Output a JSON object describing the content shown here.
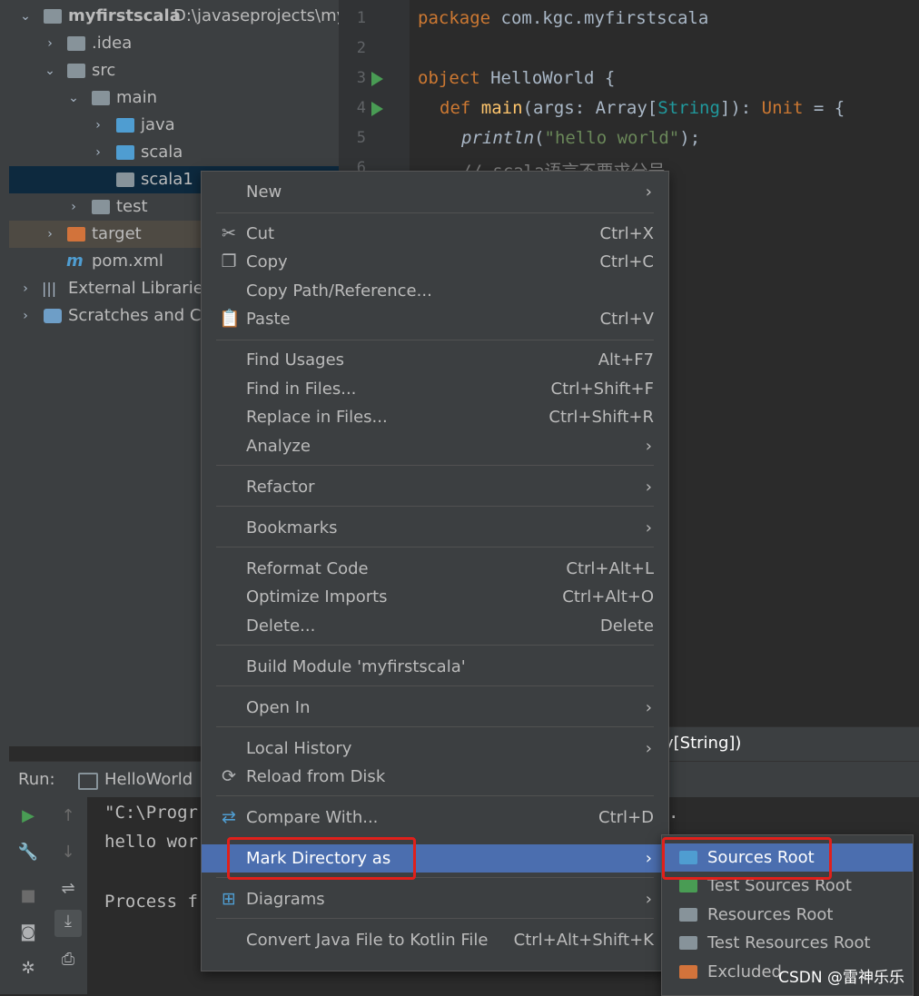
{
  "project_tree": {
    "root": {
      "name": "myfirstscala",
      "path": "D:\\javaseprojects\\my"
    },
    "items": [
      {
        "label": ".idea"
      },
      {
        "label": "src"
      },
      {
        "label": "main"
      },
      {
        "label": "java"
      },
      {
        "label": "scala"
      },
      {
        "label": "scala1"
      },
      {
        "label": "test"
      },
      {
        "label": "target"
      },
      {
        "label": "pom.xml"
      },
      {
        "label": "External Libraries"
      },
      {
        "label": "Scratches and Co"
      }
    ]
  },
  "editor": {
    "line_numbers": [
      "1",
      "2",
      "3",
      "4",
      "5",
      "6"
    ],
    "lines": {
      "l1_kw": "package",
      "l1_rest": " com.kgc.myfirstscala",
      "l3_kw": "object",
      "l3_rest": " HelloWorld {",
      "l4_kw": "def",
      "l4_fn": " main",
      "l4_a": "(args: Array[",
      "l4_gen": "String",
      "l4_b": "]): ",
      "l4_ty": "Unit",
      "l4_c": " = {",
      "l5_fn": "println",
      "l5_a": "(",
      "l5_str": "\"hello world\"",
      "l5_b": ");",
      "l6_cmt": "// scala语言不要求分号"
    }
  },
  "breadcrumb": {
    "text": "y[String])"
  },
  "run_panel": {
    "label": "Run:",
    "tab": "HelloWorld",
    "console": [
      "\"C:\\Progr",
      "hello wor",
      "",
      "Process f"
    ],
    "console_tail": "."
  },
  "context_menu": {
    "items": [
      {
        "label": "New",
        "shortcut": "",
        "submenu": true
      },
      {
        "label": "Cut",
        "shortcut": "Ctrl+X"
      },
      {
        "label": "Copy",
        "shortcut": "Ctrl+C"
      },
      {
        "label": "Copy Path/Reference...",
        "shortcut": ""
      },
      {
        "label": "Paste",
        "shortcut": "Ctrl+V"
      },
      {
        "label": "Find Usages",
        "shortcut": "Alt+F7"
      },
      {
        "label": "Find in Files...",
        "shortcut": "Ctrl+Shift+F"
      },
      {
        "label": "Replace in Files...",
        "shortcut": "Ctrl+Shift+R"
      },
      {
        "label": "Analyze",
        "shortcut": "",
        "submenu": true
      },
      {
        "label": "Refactor",
        "shortcut": "",
        "submenu": true
      },
      {
        "label": "Bookmarks",
        "shortcut": "",
        "submenu": true
      },
      {
        "label": "Reformat Code",
        "shortcut": "Ctrl+Alt+L"
      },
      {
        "label": "Optimize Imports",
        "shortcut": "Ctrl+Alt+O"
      },
      {
        "label": "Delete...",
        "shortcut": "Delete"
      },
      {
        "label": "Build Module 'myfirstscala'",
        "shortcut": ""
      },
      {
        "label": "Open In",
        "shortcut": "",
        "submenu": true
      },
      {
        "label": "Local History",
        "shortcut": "",
        "submenu": true
      },
      {
        "label": "Reload from Disk",
        "shortcut": ""
      },
      {
        "label": "Compare With...",
        "shortcut": "Ctrl+D"
      },
      {
        "label": "Mark Directory as",
        "shortcut": "",
        "submenu": true
      },
      {
        "label": "Diagrams",
        "shortcut": "",
        "submenu": true
      },
      {
        "label": "Convert Java File to Kotlin File",
        "shortcut": "Ctrl+Alt+Shift+K"
      }
    ],
    "submenu_arrow": "›"
  },
  "mark_directory_submenu": {
    "items": [
      {
        "label": "Sources Root",
        "color": "#4f9dd1"
      },
      {
        "label": "Test Sources Root",
        "color": "#499c54"
      },
      {
        "label": "Resources Root",
        "color": "#87939a"
      },
      {
        "label": "Test Resources Root",
        "color": "#87939a"
      },
      {
        "label": "Excluded",
        "color": "#d2733b"
      }
    ]
  },
  "watermark": "CSDN @雷神乐乐",
  "colors": {
    "highlight": "#4b6eaf",
    "callout": "#e0201b",
    "run_green": "#499c54"
  }
}
